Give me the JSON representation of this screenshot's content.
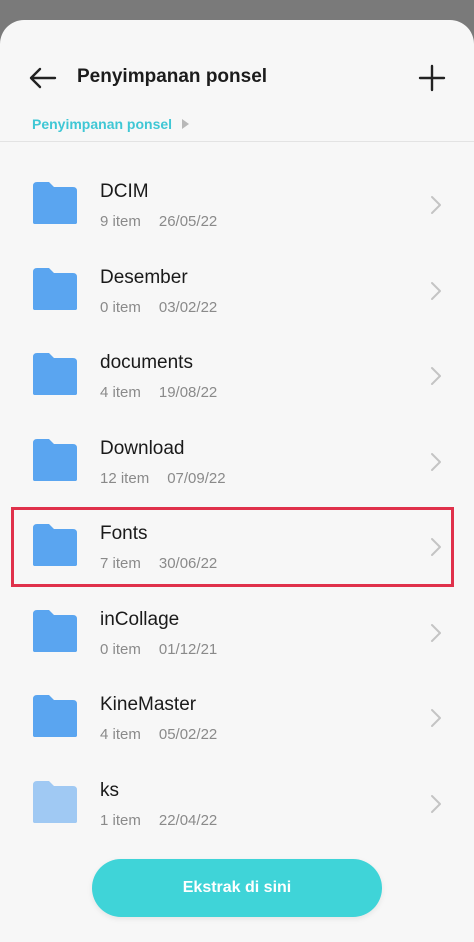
{
  "header": {
    "title": "Penyimpanan ponsel",
    "back_icon": "arrow-left-icon",
    "add_icon": "plus-icon"
  },
  "breadcrumb": [
    "Penyimpanan ponsel"
  ],
  "folders": [
    {
      "name": "DCIM",
      "count": "9 item",
      "date": "26/05/22"
    },
    {
      "name": "Desember",
      "count": "0 item",
      "date": "03/02/22"
    },
    {
      "name": "documents",
      "count": "4 item",
      "date": "19/08/22"
    },
    {
      "name": "Download",
      "count": "12 item",
      "date": "07/09/22"
    },
    {
      "name": "Fonts",
      "count": "7 item",
      "date": "30/06/22",
      "highlighted": true
    },
    {
      "name": "inCollage",
      "count": "0 item",
      "date": "01/12/21"
    },
    {
      "name": "KineMaster",
      "count": "4 item",
      "date": "05/02/22"
    },
    {
      "name": "ks",
      "count": "1 item",
      "date": "22/04/22"
    }
  ],
  "extract_button": {
    "label": "Ekstrak di sini"
  },
  "colors": {
    "accent": "#3fc7d5",
    "button": "#3fd4d8",
    "folder": "#5aa5f0",
    "highlight": "#e0314b"
  }
}
